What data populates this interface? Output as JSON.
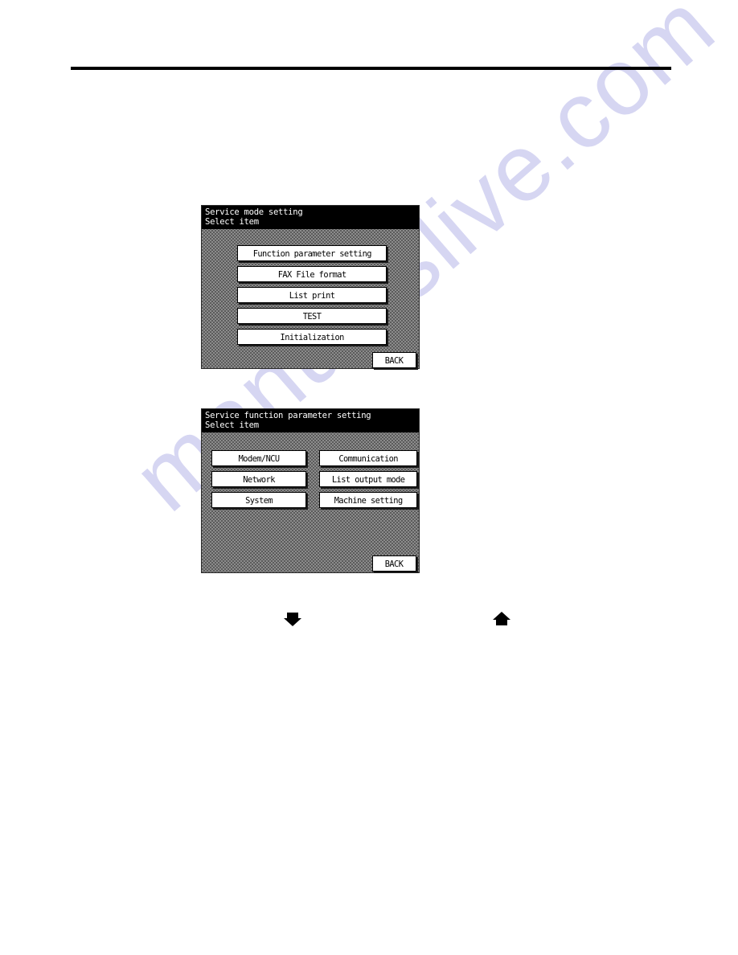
{
  "page": {
    "background_color": "#ffffff",
    "rule_color": "#000000",
    "watermark": {
      "text": "manualslive.com",
      "color": "#d6d6f2"
    }
  },
  "panels": [
    {
      "id": "service-mode-setting",
      "header": {
        "title": "Service mode setting",
        "subtitle": "Select item"
      },
      "layout": "single-column",
      "buttons": [
        {
          "label": "Function parameter setting"
        },
        {
          "label": "FAX File format"
        },
        {
          "label": "List print"
        },
        {
          "label": "TEST"
        },
        {
          "label": "Initialization"
        }
      ],
      "back_label": "BACK"
    },
    {
      "id": "service-function-parameter-setting",
      "header": {
        "title": "Service function parameter setting",
        "subtitle": "Select item"
      },
      "layout": "two-column",
      "left_buttons": [
        {
          "label": "Modem/NCU"
        },
        {
          "label": "Network"
        },
        {
          "label": "System"
        }
      ],
      "right_buttons": [
        {
          "label": "Communication"
        },
        {
          "label": "List output mode"
        },
        {
          "label": "Machine setting"
        }
      ],
      "back_label": "BACK"
    }
  ],
  "flow_markers": [
    {
      "name": "arrow-down-icon",
      "direction": "down"
    },
    {
      "name": "arrow-up-icon",
      "direction": "up"
    }
  ]
}
